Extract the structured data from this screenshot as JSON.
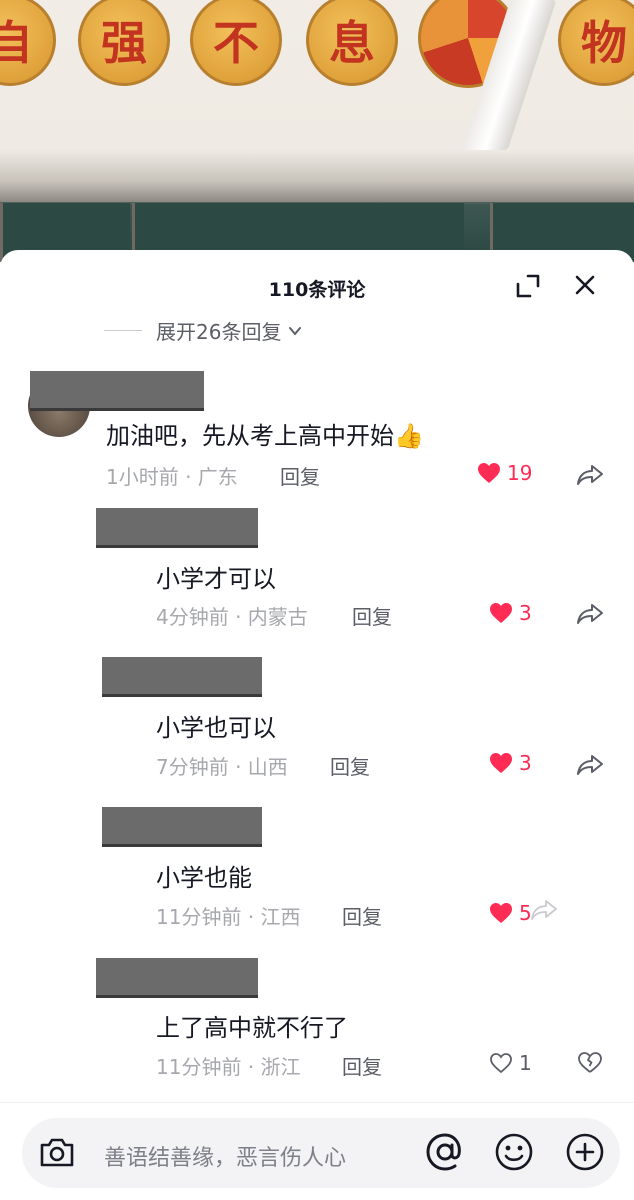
{
  "video": {
    "wall_characters": [
      "自",
      "强",
      "不",
      "息",
      "物"
    ]
  },
  "sheet": {
    "title": "110条评论",
    "expand_replies": "展开26条回复"
  },
  "comments": [
    {
      "text": "加油吧，先从考上高中开始👍",
      "meta": "1小时前 · 广东",
      "reply": "回复",
      "likes": "19",
      "liked": true
    },
    {
      "text": "小学才可以",
      "meta": "4分钟前 · 内蒙古",
      "reply": "回复",
      "likes": "3",
      "liked": true
    },
    {
      "text": "小学也可以",
      "meta": "7分钟前 · 山西",
      "reply": "回复",
      "likes": "3",
      "liked": true
    },
    {
      "text": "小学也能",
      "meta": "11分钟前 · 江西",
      "reply": "回复",
      "likes": "5",
      "liked": true
    },
    {
      "text": "上了高中就不行了",
      "meta": "11分钟前 · 浙江",
      "reply": "回复",
      "likes": "1",
      "liked": false
    }
  ],
  "input": {
    "placeholder": "善语结善缘，恶言伤人心"
  },
  "colors": {
    "like_red": "#fe2c55",
    "text_primary": "#161823",
    "text_meta": "#a6a8ad"
  }
}
